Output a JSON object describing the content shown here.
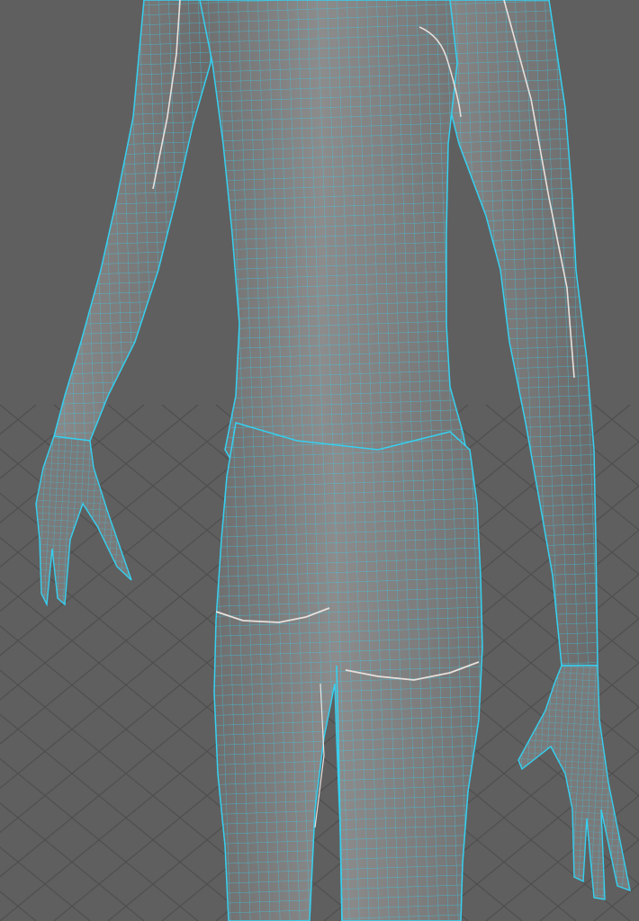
{
  "viewport": {
    "background_color": "#5f5f5f",
    "grid_color": "#4f4f4f",
    "mesh_fill_color": "#808080",
    "wire_color": "#35d0f0",
    "seam_color": "#e8e0dc",
    "grid_visible": true,
    "wireframe_on_shaded": true,
    "selected_object": "character-body-mesh"
  }
}
